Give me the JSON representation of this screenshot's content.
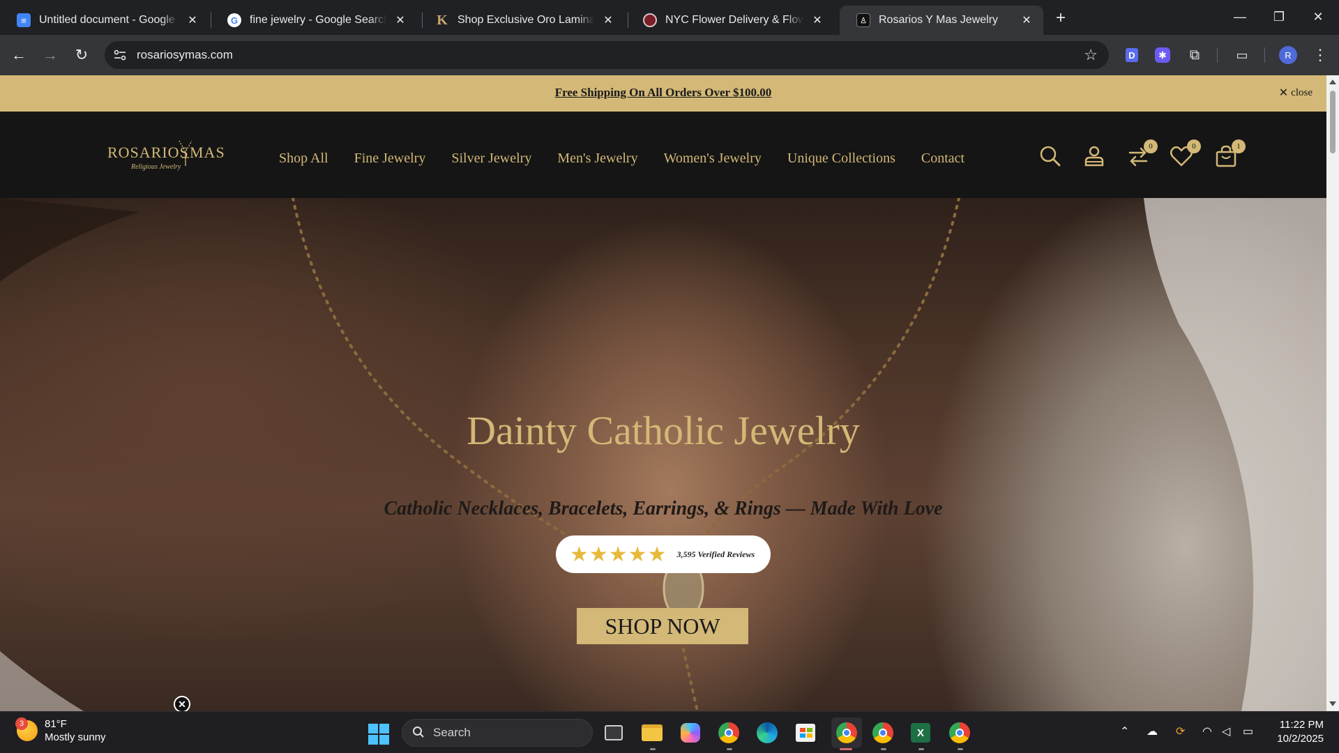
{
  "browser": {
    "tabs": [
      {
        "title": "Untitled document - Google Docs",
        "icon": "google-docs-icon",
        "active": false
      },
      {
        "title": "fine jewelry - Google Search",
        "icon": "google-icon",
        "active": false
      },
      {
        "title": "Shop Exclusive Oro Laminado Wholesale",
        "icon": "k-brand-icon",
        "active": false
      },
      {
        "title": "NYC Flower Delivery & Flower Shop",
        "icon": "flower-shop-icon",
        "active": false
      },
      {
        "title": "Rosarios Y Mas Jewelry",
        "icon": "rosarios-icon",
        "active": true
      }
    ],
    "url": "rosariosymas.com",
    "profile_initial": "R"
  },
  "site": {
    "announcement": "Free Shipping On All Orders Over $100.00",
    "announcement_close": "close",
    "logo": {
      "word_left": "ROSARIOS",
      "word_right": "MAS",
      "subtitle": "Religious Jewelry"
    },
    "nav": [
      "Shop All",
      "Fine Jewelry",
      "Silver Jewelry",
      "Men's Jewelry",
      "Women's Jewelry",
      "Unique Collections",
      "Contact"
    ],
    "header_icons": {
      "compare_count": "0",
      "wishlist_count": "0",
      "cart_count": "1"
    },
    "hero": {
      "heading": "Dainty Catholic Jewelry",
      "tagline": "Catholic Necklaces, Bracelets, Earrings, & Rings — Made With Love",
      "stars": "★★★★★",
      "rating_stars": 5,
      "reviews": "3,595 Verified Reviews",
      "cta": "SHOP NOW"
    },
    "colors": {
      "gold": "#d3b877",
      "header_bg": "#151515",
      "star": "#e7b93a"
    }
  },
  "taskbar": {
    "weather_temp": "81°F",
    "weather_desc": "Mostly sunny",
    "weather_badge": "3",
    "search_placeholder": "Search",
    "time": "11:22 PM",
    "date": "10/2/2025"
  }
}
